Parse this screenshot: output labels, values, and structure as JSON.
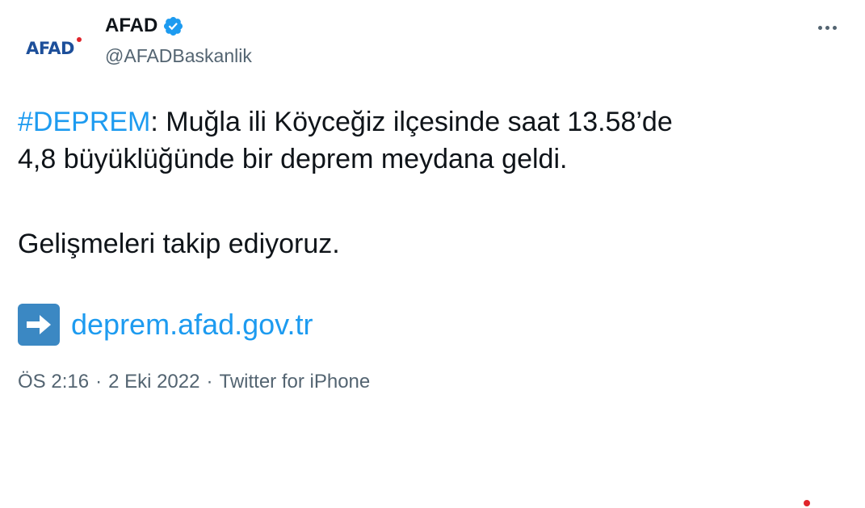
{
  "author": {
    "avatar_text": "AFAD",
    "name": "AFAD",
    "handle": "@AFADBaskanlik",
    "verified": true
  },
  "tweet": {
    "hashtag": "#DEPREM",
    "line1_rest": ": Muğla ili Köyceğiz ilçesinde saat 13.58’de",
    "line2": "4,8 büyüklüğünde bir deprem meydana geldi.",
    "paragraph2": "Gelişmeleri takip ediyoruz.",
    "link_icon": "right-arrow-emoji",
    "link_text": "deprem.afad.gov.tr"
  },
  "meta": {
    "time": "ÖS 2:16",
    "separator": "·",
    "date": "2 Eki 2022",
    "source": "Twitter for iPhone"
  },
  "colors": {
    "accent": "#1d9bf0",
    "text": "#0f1419",
    "secondary": "#536471",
    "brand_blue": "#1d4f9a",
    "brand_red": "#e0242b",
    "emoji_blue": "#3b88c3"
  }
}
